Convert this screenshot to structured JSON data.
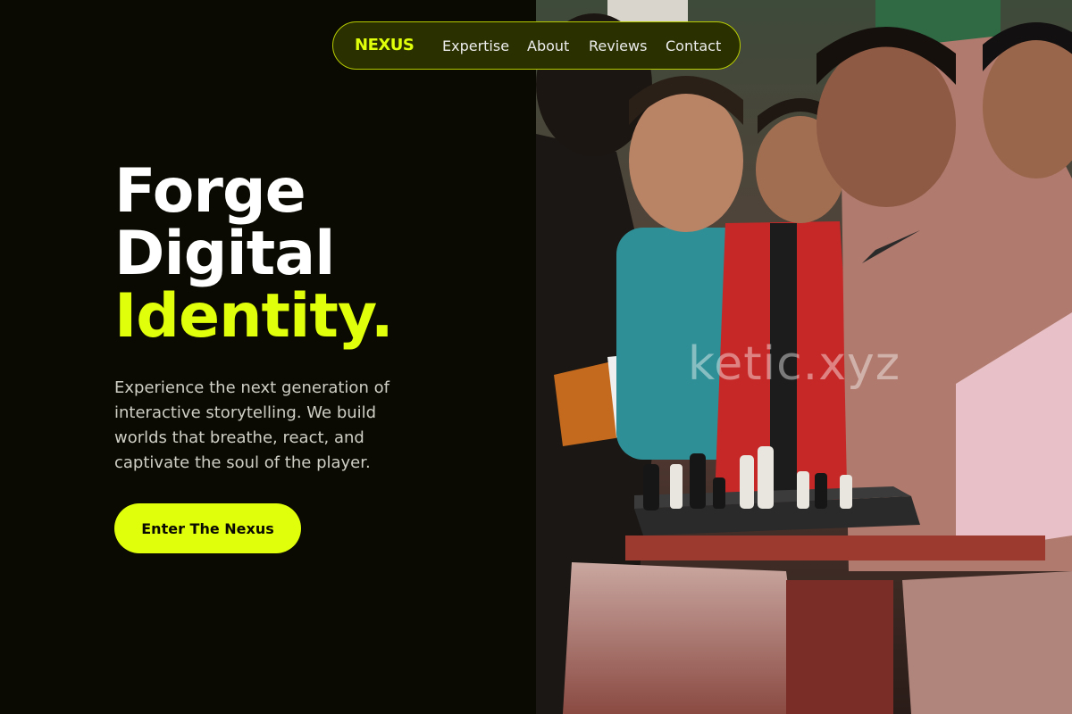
{
  "nav": {
    "logo": "NEXUS",
    "links": [
      "Expertise",
      "About",
      "Reviews",
      "Contact"
    ]
  },
  "hero": {
    "headline_line1": "Forge",
    "headline_line2": "Digital",
    "headline_accent": "Identity.",
    "description": "Experience the next generation of interactive storytelling. We build worlds that breathe, react, and captivate the soul of the player.",
    "cta_label": "Enter The Nexus"
  },
  "image": {
    "watermark": "ketic.xyz"
  },
  "colors": {
    "background": "#0a0a02",
    "accent": "#dfff0a",
    "text": "#ffffff",
    "muted_text": "#cfcfc6",
    "nav_background": "#2a3000"
  }
}
